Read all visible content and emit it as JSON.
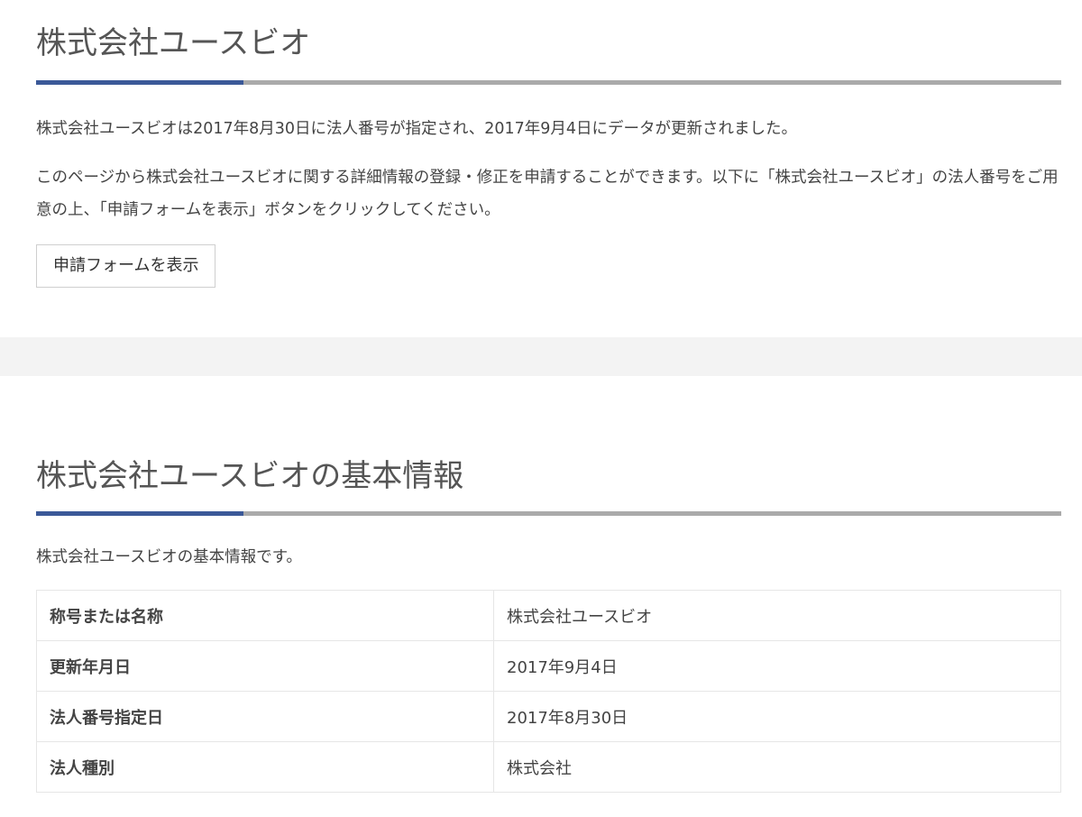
{
  "company": {
    "title": "株式会社ユースビオ",
    "summary": "株式会社ユースビオは2017年8月30日に法人番号が指定され、2017年9月4日にデータが更新されました。",
    "instructions": "このページから株式会社ユースビオに関する詳細情報の登録・修正を申請することができます。以下に「株式会社ユースビオ」の法人番号をご用意の上、「申請フォームを表示」ボタンをクリックしてください。",
    "form_button_label": "申請フォームを表示"
  },
  "basic_info": {
    "title": "株式会社ユースビオの基本情報",
    "intro": "株式会社ユースビオの基本情報です。",
    "rows": [
      {
        "key": "称号または名称",
        "value": "株式会社ユースビオ"
      },
      {
        "key": "更新年月日",
        "value": "2017年9月4日"
      },
      {
        "key": "法人番号指定日",
        "value": "2017年8月30日"
      },
      {
        "key": "法人種別",
        "value": "株式会社"
      }
    ]
  },
  "colors": {
    "accent": "#3b5998",
    "rule": "#aaaaaa",
    "band": "#f3f3f3"
  }
}
